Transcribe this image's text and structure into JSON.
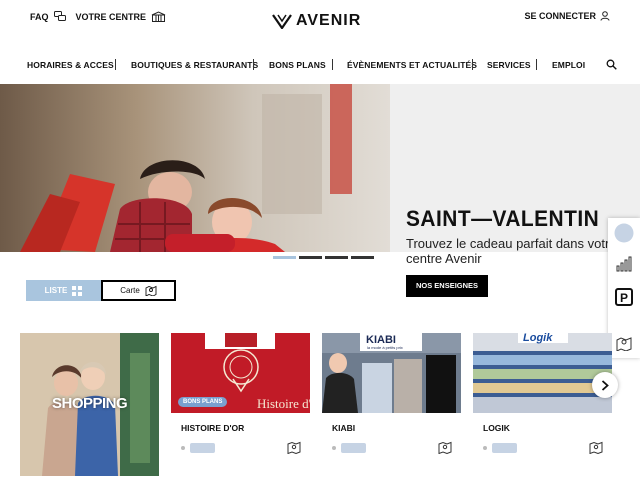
{
  "topbar": {
    "faq_label": "FAQ",
    "center_label": "VOTRE CENTRE",
    "logo_text": "AVENIR",
    "login_label": "SE CONNECTER"
  },
  "nav": {
    "items": [
      "HORAIRES & ACCES",
      "BOUTIQUES & RESTAURANTS",
      "BONS PLANS",
      "ÉVÈNEMENTS ET ACTUALITÉS",
      "SERVICES",
      "EMPLOI"
    ]
  },
  "hero": {
    "title": "SAINT—VALENTIN",
    "subtitle": "Trouvez le cadeau parfait dans votre centre Avenir",
    "button_label": "NOS ENSEIGNES",
    "slides": 4,
    "active_slide": 1
  },
  "view_toggle": {
    "list_label": "LISTE",
    "map_label": "Carte",
    "selected": "LISTE"
  },
  "promo": {
    "label": "SHOPPING"
  },
  "stores": [
    {
      "name": "HISTOIRE D'OR",
      "badge": "BONS PLANS",
      "logo_text": "Histoire d'Or",
      "sign_text": "Histoire d'Or"
    },
    {
      "name": "KIABI",
      "badge": "",
      "logo_text": "KIABI",
      "logo_tagline": "la mode à petits prix"
    },
    {
      "name": "LOGIK",
      "badge": "",
      "logo_text": "Logik"
    }
  ],
  "colors": {
    "accent_light_blue": "#a9c5de",
    "badge_blue": "#7aa0cf",
    "black": "#000000"
  }
}
